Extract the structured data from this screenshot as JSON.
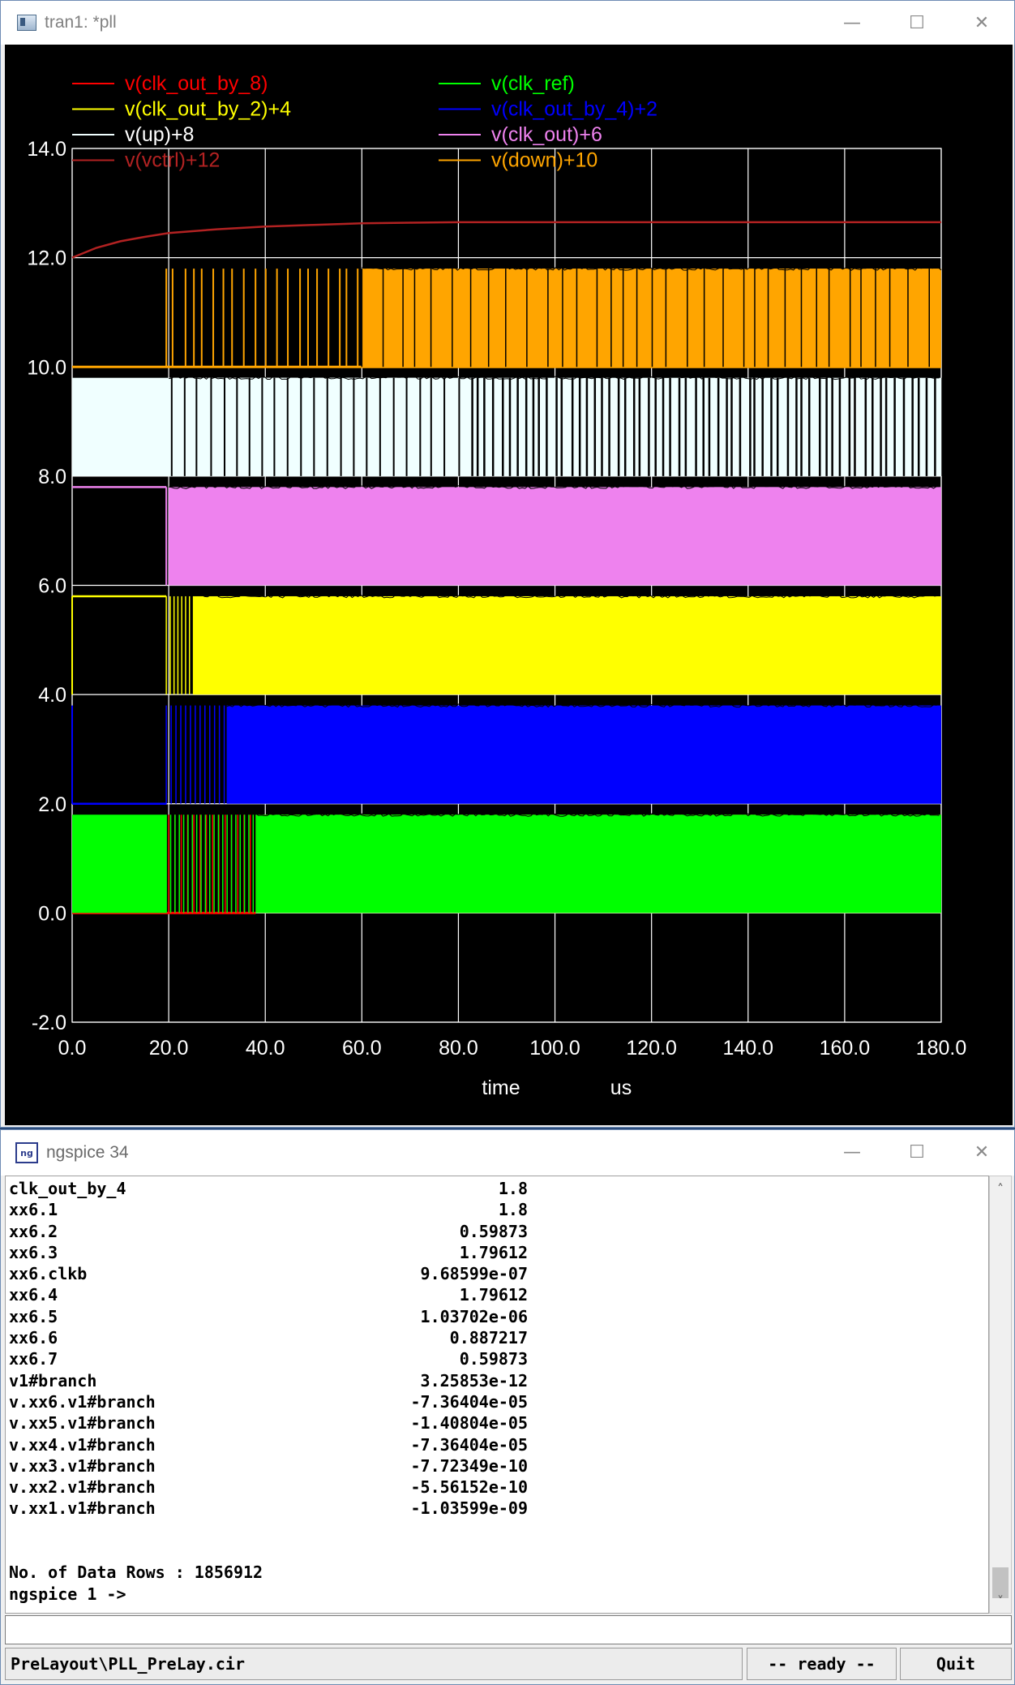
{
  "plot_window": {
    "title": "tran1: *pll",
    "controls": {
      "minimize": "—",
      "maximize": "☐",
      "close": "✕"
    }
  },
  "chart_data": {
    "type": "line",
    "title": "",
    "xlabel": "time",
    "xunit": "us",
    "xlim": [
      0,
      180
    ],
    "ylim": [
      -2,
      14
    ],
    "x_ticks": [
      "0.0",
      "20.0",
      "40.0",
      "60.0",
      "80.0",
      "100.0",
      "120.0",
      "140.0",
      "160.0",
      "180.0"
    ],
    "y_ticks": [
      "14.0",
      "12.0",
      "10.0",
      "8.0",
      "6.0",
      "4.0",
      "2.0",
      "0.0",
      "-2.0"
    ],
    "grid": true,
    "legend_position": "top",
    "series": [
      {
        "name": "v(clk_out_by_8)",
        "color": "#ff0000",
        "offset": 0,
        "signal": {
          "low": 0,
          "high": 1.8,
          "lock_us": 38
        }
      },
      {
        "name": "v(clk_ref)",
        "color": "#00ff00",
        "offset": 0,
        "signal": {
          "low": 0,
          "high": 1.8,
          "lock_us": 38
        }
      },
      {
        "name": "v(clk_out_by_2)+4",
        "color": "#ffff00",
        "offset": 4,
        "signal": {
          "low": 0,
          "high": 1.8,
          "lock_us": 25
        }
      },
      {
        "name": "v(clk_out_by_4)+2",
        "color": "#0000ff",
        "offset": 2,
        "signal": {
          "low": 0,
          "high": 1.8,
          "lock_us": 32
        }
      },
      {
        "name": "v(up)+8",
        "color": "#f0ffff",
        "offset": 8,
        "signal": {
          "low": 0,
          "high": 1.8,
          "lock_us": 20
        }
      },
      {
        "name": "v(clk_out)+6",
        "color": "#ee82ee",
        "offset": 6,
        "signal": {
          "low": 0,
          "high": 1.8,
          "lock_us": 20
        }
      },
      {
        "name": "v(vctrl)+12",
        "color": "#b22222",
        "offset": 12,
        "points": [
          [
            0,
            0.0
          ],
          [
            5,
            0.18
          ],
          [
            10,
            0.3
          ],
          [
            15,
            0.38
          ],
          [
            20,
            0.45
          ],
          [
            30,
            0.52
          ],
          [
            40,
            0.57
          ],
          [
            50,
            0.6
          ],
          [
            60,
            0.63
          ],
          [
            70,
            0.64
          ],
          [
            80,
            0.65
          ],
          [
            100,
            0.65
          ],
          [
            140,
            0.65
          ],
          [
            180,
            0.65
          ]
        ]
      },
      {
        "name": "v(down)+10",
        "color": "#ffa500",
        "offset": 10,
        "signal": {
          "low": 0,
          "high": 1.8,
          "lock_us": 60
        }
      }
    ]
  },
  "console_window": {
    "title": "ngspice 34",
    "variables": [
      {
        "name": "clk_out_by_4",
        "value": "1.8"
      },
      {
        "name": "xx6.1",
        "value": "1.8"
      },
      {
        "name": "xx6.2",
        "value": "0.59873"
      },
      {
        "name": "xx6.3",
        "value": "1.79612"
      },
      {
        "name": "xx6.clkb",
        "value": "9.68599e-07"
      },
      {
        "name": "xx6.4",
        "value": "1.79612"
      },
      {
        "name": "xx6.5",
        "value": "1.03702e-06"
      },
      {
        "name": "xx6.6",
        "value": "0.887217"
      },
      {
        "name": "xx6.7",
        "value": "0.59873"
      },
      {
        "name": "v1#branch",
        "value": "3.25853e-12"
      },
      {
        "name": "v.xx6.v1#branch",
        "value": "-7.36404e-05"
      },
      {
        "name": "v.xx5.v1#branch",
        "value": "-1.40804e-05"
      },
      {
        "name": "v.xx4.v1#branch",
        "value": "-7.36404e-05"
      },
      {
        "name": "v.xx3.v1#branch",
        "value": "-7.72349e-10"
      },
      {
        "name": "v.xx2.v1#branch",
        "value": "-5.56152e-10"
      },
      {
        "name": "v.xx1.v1#branch",
        "value": "-1.03599e-09"
      }
    ],
    "data_rows_line": "No. of Data Rows : 1856912",
    "prompt_line": "ngspice 1 ->",
    "input_value": "",
    "status_file": "PreLayout\\PLL_PreLay.cir",
    "status_state": "-- ready --",
    "quit_label": "Quit",
    "scroll_up": "˄",
    "scroll_down": "˅"
  }
}
